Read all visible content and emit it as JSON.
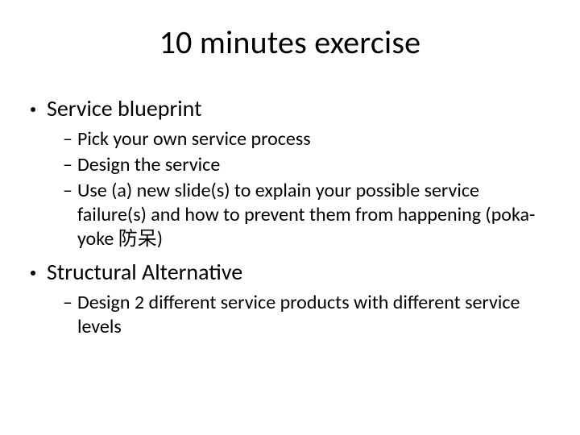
{
  "title": "10 minutes exercise",
  "items": [
    {
      "label": "Service blueprint",
      "sub": [
        "Pick your own service process",
        "Design the service",
        "Use (a) new slide(s) to explain your possible service failure(s) and how to prevent them from happening (poka-yoke 防呆)"
      ]
    },
    {
      "label": "Structural Alternative",
      "sub": [
        "Design 2 different service products with different service levels"
      ]
    }
  ]
}
